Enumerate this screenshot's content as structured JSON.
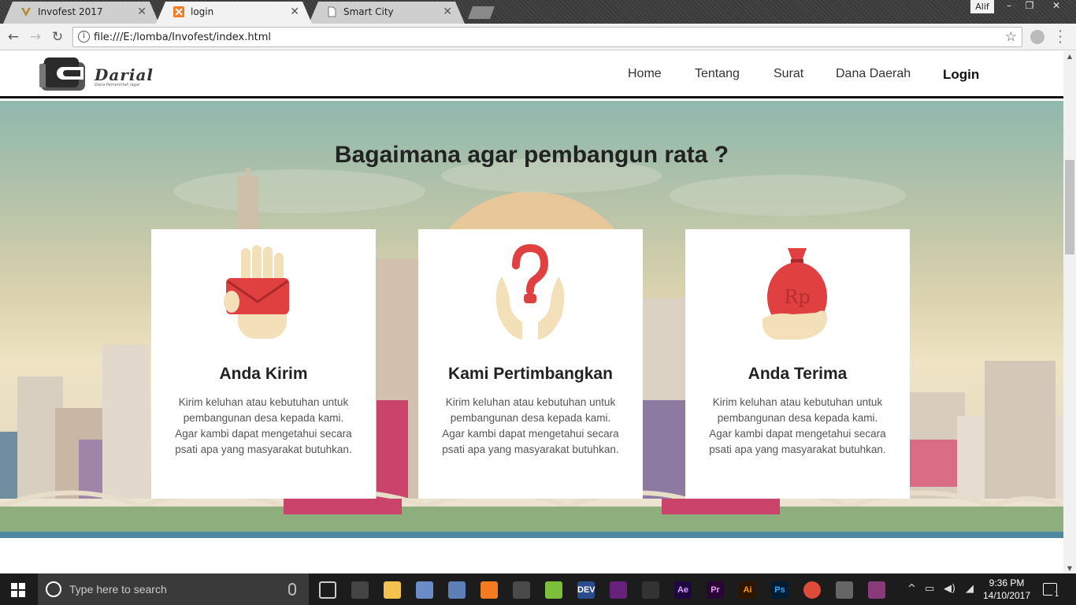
{
  "browser": {
    "tabs": [
      {
        "title": "Invofest 2017",
        "icon": "v-logo-icon"
      },
      {
        "title": "login",
        "icon": "xampp-icon"
      },
      {
        "title": "Smart City",
        "icon": "page-icon"
      }
    ],
    "user": "Alif",
    "window_controls": [
      "–",
      "❐",
      "✕"
    ],
    "url": "file:///E:/lomba/Invofest/index.html"
  },
  "site": {
    "logo_text": "Darial",
    "logo_tagline": "Dana Pemerintah lagal",
    "nav": [
      "Home",
      "Tentang",
      "Surat",
      "Dana Daerah",
      "Login"
    ],
    "hero_title": "Bagaimana agar pembangun rata ?",
    "cards": [
      {
        "icon": "hand-envelope-icon",
        "title": "Anda Kirim",
        "text": "Kirim keluhan atau kebutuhan untuk pembangunan desa kepada kami. Agar kambi dapat mengetahui secara psati apa yang masyarakat butuhkan."
      },
      {
        "icon": "hands-question-icon",
        "title": "Kami Pertimbangkan",
        "text": "Kirim keluhan atau kebutuhan untuk pembangunan desa kepada kami. Agar kambi dapat mengetahui secara psati apa yang masyarakat butuhkan."
      },
      {
        "icon": "money-bag-icon",
        "title": "Anda Terima",
        "text": "Kirim keluhan atau kebutuhan untuk pembangunan desa kepada kami. Agar kambi dapat mengetahui secara psati apa yang masyarakat butuhkan."
      }
    ],
    "money_bag_label": "Rp",
    "colors": {
      "accent_red": "#e0403f",
      "skin": "#f3dfb8",
      "header_border": "#111111"
    }
  },
  "taskbar": {
    "search_placeholder": "Type here to search",
    "apps": [
      {
        "name": "task-view-icon",
        "label": ""
      },
      {
        "name": "store-icon",
        "label": ""
      },
      {
        "name": "file-explorer-icon",
        "label": ""
      },
      {
        "name": "3d-box-icon",
        "label": ""
      },
      {
        "name": "vbox-icon",
        "label": ""
      },
      {
        "name": "xampp-icon",
        "label": ""
      },
      {
        "name": "sublime-icon",
        "label": ""
      },
      {
        "name": "android-studio-icon",
        "label": ""
      },
      {
        "name": "devcpp-icon",
        "label": "DEV"
      },
      {
        "name": "visual-studio-icon",
        "label": ""
      },
      {
        "name": "media-icon",
        "label": ""
      },
      {
        "name": "after-effects-icon",
        "label": "Ae"
      },
      {
        "name": "premiere-icon",
        "label": "Pr"
      },
      {
        "name": "illustrator-icon",
        "label": "Ai"
      },
      {
        "name": "photoshop-icon",
        "label": "Ps"
      },
      {
        "name": "chrome-icon",
        "label": ""
      },
      {
        "name": "droplet-icon",
        "label": ""
      },
      {
        "name": "winrar-icon",
        "label": ""
      }
    ],
    "time": "9:36 PM",
    "date": "14/10/2017",
    "notifications": "1"
  }
}
